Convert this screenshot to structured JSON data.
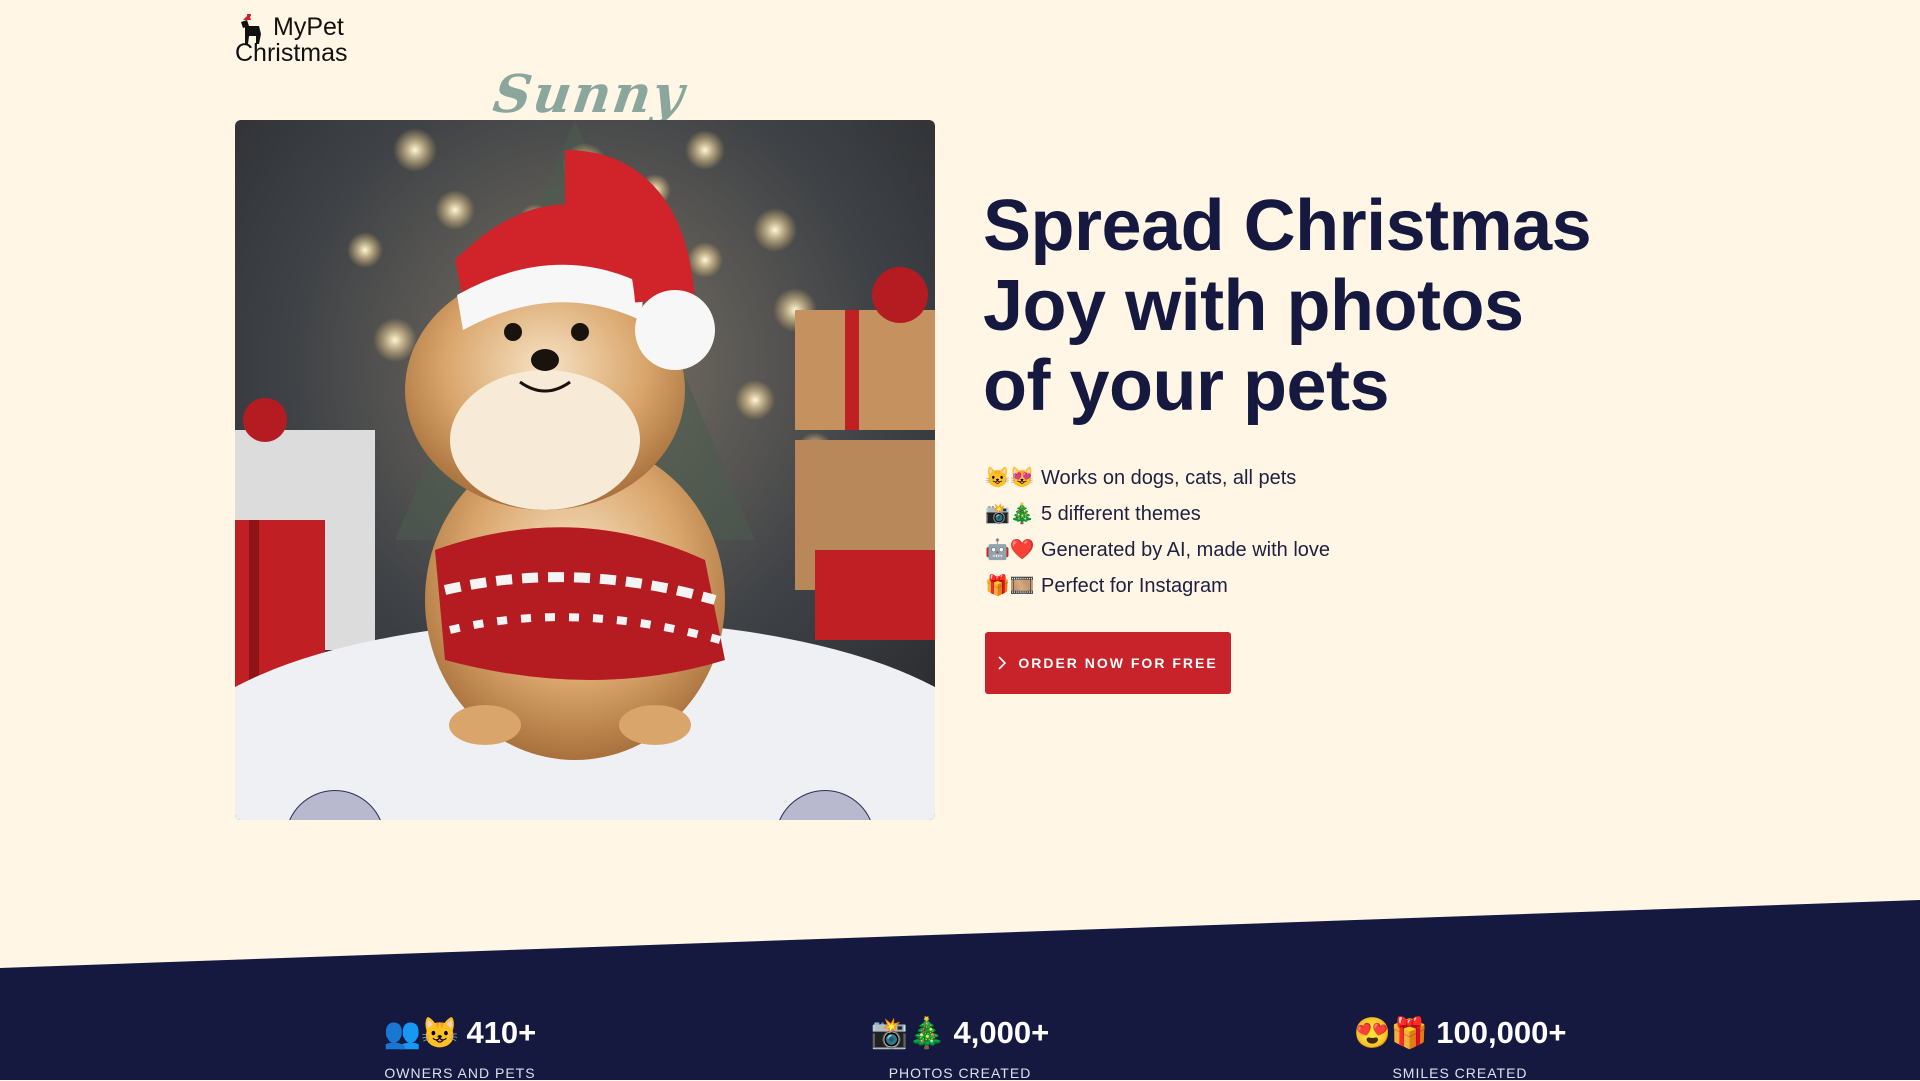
{
  "header": {
    "logo_line1": "MyPet",
    "logo_line2": "Christmas"
  },
  "carousel": {
    "pet_name": "Sunny",
    "image_alt": "Pomeranian wearing a Santa hat and red Christmas sweater"
  },
  "hero": {
    "headline": "Spread Christmas Joy with photos of your pets",
    "features": [
      {
        "emoji": "😺😻",
        "text": "Works on dogs, cats, all pets"
      },
      {
        "emoji": "📸🎄",
        "text": "5 different themes"
      },
      {
        "emoji": "🤖❤️",
        "text": "Generated by AI, made with love"
      },
      {
        "emoji": "🎁🎞️",
        "text": "Perfect for Instagram"
      }
    ],
    "cta_label": "ORDER NOW FOR FREE"
  },
  "stats": [
    {
      "emoji": "👥😺",
      "value": "410+",
      "label": "OWNERS AND PETS"
    },
    {
      "emoji": "📸🎄",
      "value": "4,000+",
      "label": "PHOTOS CREATED"
    },
    {
      "emoji": "😍🎁",
      "value": "100,000+",
      "label": "SMILES CREATED"
    }
  ],
  "colors": {
    "background": "#fff6e5",
    "navy": "#16193f",
    "cta": "#c8232b",
    "pet_name": "#8aa69d"
  }
}
